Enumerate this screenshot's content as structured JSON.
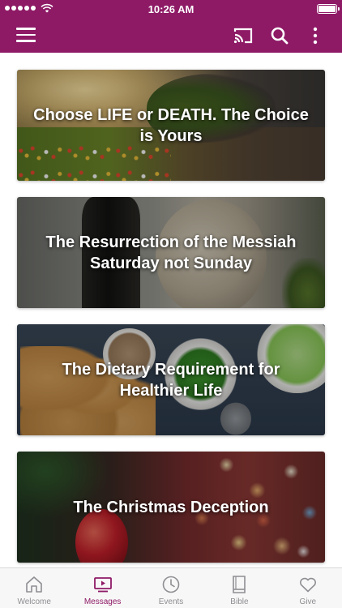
{
  "status_bar": {
    "time": "10:26 AM"
  },
  "app_bar": {
    "background": "#8e1a66",
    "icons": [
      "menu-icon",
      "cast-icon",
      "search-icon",
      "more-vertical-icon"
    ]
  },
  "messages": [
    {
      "title": "Choose LIFE or DEATH. The Choice is Yours"
    },
    {
      "title": "The Resurrection of the Messiah Saturday not Sunday"
    },
    {
      "title": "The Dietary Requirement for Healthier Life"
    },
    {
      "title": "The Christmas Deception"
    }
  ],
  "tabs": [
    {
      "label": "Welcome",
      "icon": "home-icon",
      "active": false
    },
    {
      "label": "Messages",
      "icon": "video-icon",
      "active": true
    },
    {
      "label": "Events",
      "icon": "clock-icon",
      "active": false
    },
    {
      "label": "Bible",
      "icon": "book-icon",
      "active": false
    },
    {
      "label": "Give",
      "icon": "heart-icon",
      "active": false
    }
  ],
  "colors": {
    "accent": "#8e1a66",
    "tab_inactive": "#8e8e93"
  }
}
